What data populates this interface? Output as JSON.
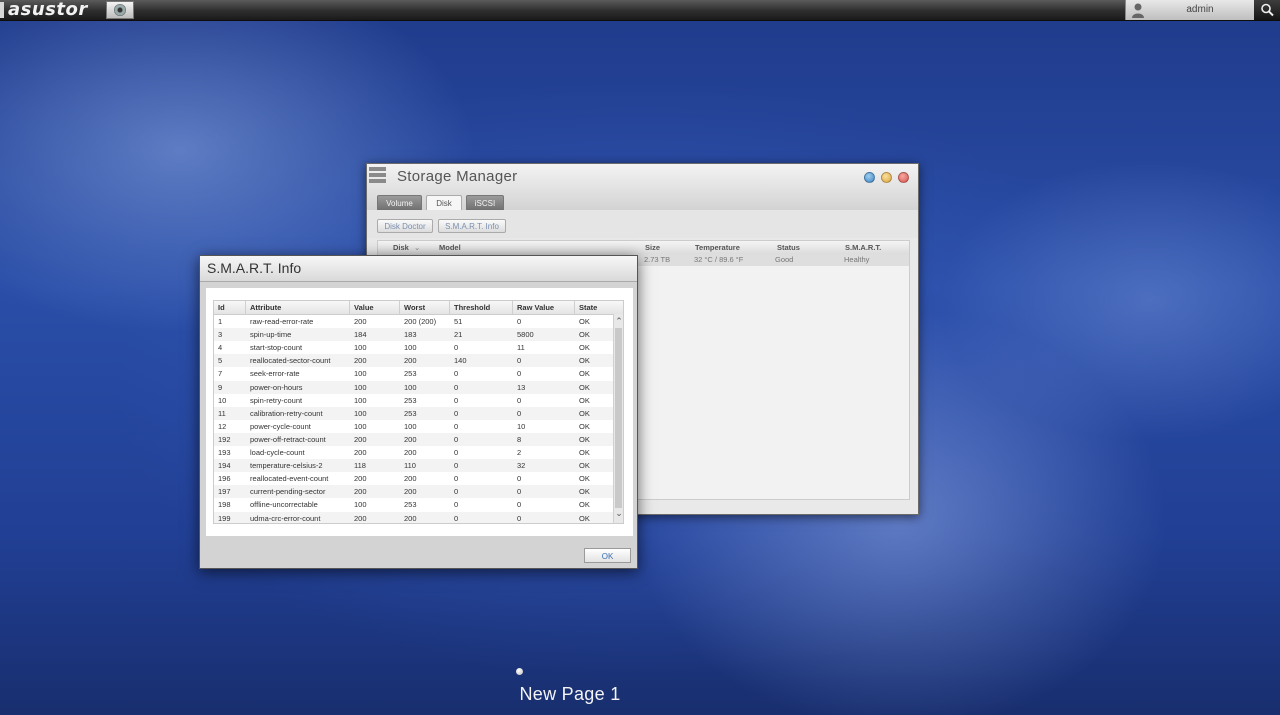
{
  "topbar": {
    "logo_text": "asustor",
    "username": "admin",
    "icons": {
      "app": "disc-icon",
      "user": "user-icon",
      "search": "search-icon"
    }
  },
  "storage_manager": {
    "title": "Storage Manager",
    "tabs": [
      {
        "label": "Volume",
        "active": false
      },
      {
        "label": "Disk",
        "active": true
      },
      {
        "label": "iSCSI",
        "active": false
      }
    ],
    "toolbar": {
      "disk_doctor": "Disk Doctor",
      "smart_info": "S.M.A.R.T. Info"
    },
    "columns": {
      "disk": "Disk",
      "model": "Model",
      "size": "Size",
      "temperature": "Temperature",
      "status": "Status",
      "smart": "S.M.A.R.T."
    },
    "rows": [
      {
        "size": "2.73 TB",
        "temperature": "32 °C / 89.6 °F",
        "status": "Good",
        "smart": "Healthy"
      }
    ],
    "window_controls": {
      "help": "#4a90c8",
      "minimize": "#e0a63a",
      "close": "#d9534f"
    }
  },
  "smart_dialog": {
    "title": "S.M.A.R.T. Info",
    "columns": [
      "Id",
      "Attribute",
      "Value",
      "Worst",
      "Threshold",
      "Raw Value",
      "State"
    ],
    "rows": [
      [
        "1",
        "raw-read-error-rate",
        "200",
        "200 (200)",
        "51",
        "0",
        "OK"
      ],
      [
        "3",
        "spin-up-time",
        "184",
        "183",
        "21",
        "5800",
        "OK"
      ],
      [
        "4",
        "start-stop-count",
        "100",
        "100",
        "0",
        "11",
        "OK"
      ],
      [
        "5",
        "reallocated-sector-count",
        "200",
        "200",
        "140",
        "0",
        "OK"
      ],
      [
        "7",
        "seek-error-rate",
        "100",
        "253",
        "0",
        "0",
        "OK"
      ],
      [
        "9",
        "power-on-hours",
        "100",
        "100",
        "0",
        "13",
        "OK"
      ],
      [
        "10",
        "spin-retry-count",
        "100",
        "253",
        "0",
        "0",
        "OK"
      ],
      [
        "11",
        "calibration-retry-count",
        "100",
        "253",
        "0",
        "0",
        "OK"
      ],
      [
        "12",
        "power-cycle-count",
        "100",
        "100",
        "0",
        "10",
        "OK"
      ],
      [
        "192",
        "power-off-retract-count",
        "200",
        "200",
        "0",
        "8",
        "OK"
      ],
      [
        "193",
        "load-cycle-count",
        "200",
        "200",
        "0",
        "2",
        "OK"
      ],
      [
        "194",
        "temperature-celsius-2",
        "118",
        "110",
        "0",
        "32",
        "OK"
      ],
      [
        "196",
        "reallocated-event-count",
        "200",
        "200",
        "0",
        "0",
        "OK"
      ],
      [
        "197",
        "current-pending-sector",
        "200",
        "200",
        "0",
        "0",
        "OK"
      ],
      [
        "198",
        "offline-uncorrectable",
        "100",
        "253",
        "0",
        "0",
        "OK"
      ],
      [
        "199",
        "udma-crc-error-count",
        "200",
        "200",
        "0",
        "0",
        "OK"
      ]
    ],
    "ok_label": "OK"
  },
  "desktop": {
    "page_label": "New Page 1"
  }
}
